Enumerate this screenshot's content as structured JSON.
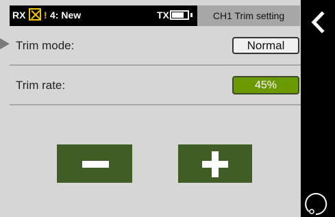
{
  "status_bar": {
    "rx_label": "RX",
    "warning_symbol": "!",
    "model_name": "4: New",
    "tx_label": "TX",
    "battery_level": 0.72,
    "rx_status_icon": "x-box-icon",
    "battery_icon": "battery-icon"
  },
  "screen": {
    "title": "CH1 Trim setting"
  },
  "settings": {
    "trim_mode_label": "Trim mode:",
    "trim_mode_value": "Normal",
    "trim_rate_label": "Trim rate:",
    "trim_rate_value": "45%",
    "trim_rate_percent": 45
  },
  "controls": {
    "decrement_icon": "minus-icon",
    "increment_icon": "plus-icon"
  },
  "navigation": {
    "back_icon": "chevron-left-icon",
    "rotate_icon": "rotate-icon"
  },
  "colors": {
    "accent_green": "#6b9a00",
    "button_green": "#3f5d24",
    "warning_yellow": "#f2c300",
    "header_gray": "#a7a7a7",
    "background": "#d6d6d6"
  }
}
